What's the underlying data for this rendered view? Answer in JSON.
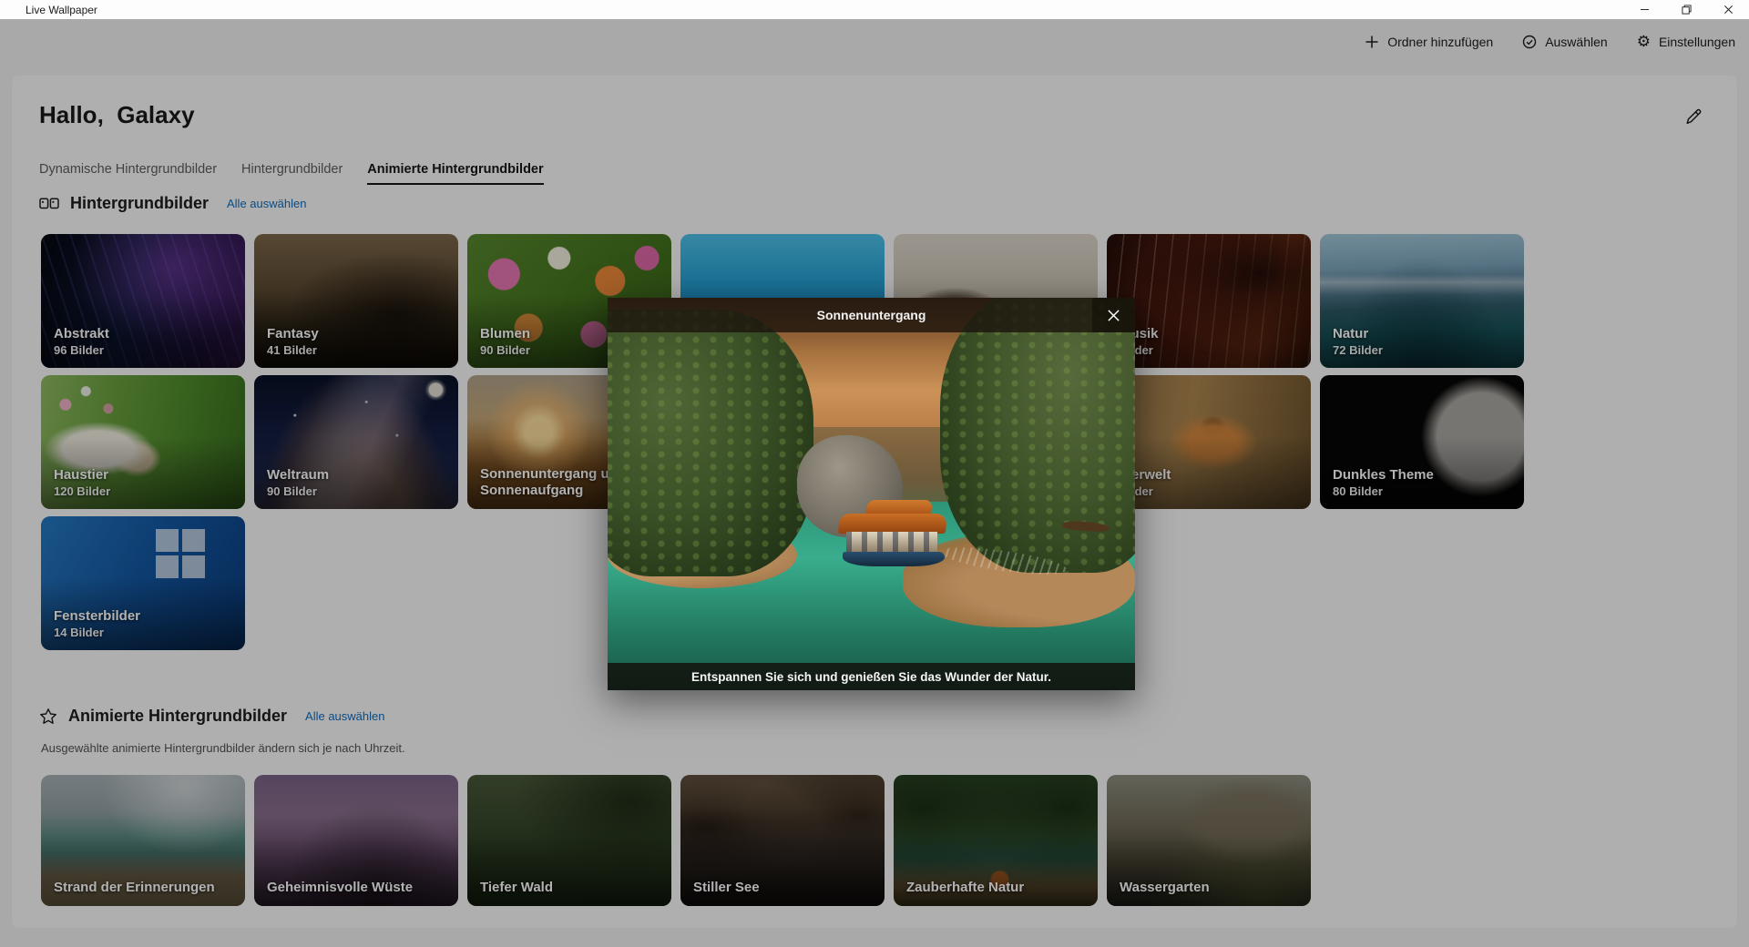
{
  "window": {
    "title": "Live Wallpaper"
  },
  "toolbar": {
    "add_folder": "Ordner hinzufügen",
    "select": "Auswählen",
    "settings": "Einstellungen"
  },
  "page": {
    "greeting": "Hallo,  Galaxy",
    "tabs": [
      {
        "label": "Dynamische Hintergrundbilder",
        "active": false
      },
      {
        "label": "Hintergrundbilder",
        "active": false
      },
      {
        "label": "Animierte Hintergrundbilder",
        "active": true
      }
    ]
  },
  "wallpaper_section": {
    "title": "Hintergrundbilder",
    "select_all": "Alle auswählen",
    "tiles": [
      {
        "name": "Abstrakt",
        "count": "96 Bilder"
      },
      {
        "name": "Fantasy",
        "count": "41 Bilder"
      },
      {
        "name": "Blumen",
        "count": "90 Bilder"
      },
      {
        "name": "",
        "count": ""
      },
      {
        "name": "",
        "count": ""
      },
      {
        "name": "Musik",
        "count": "Bilder"
      },
      {
        "name": "Natur",
        "count": "72 Bilder"
      },
      {
        "name": "Haustier",
        "count": "120 Bilder"
      },
      {
        "name": "Weltraum",
        "count": "90 Bilder"
      },
      {
        "name": "Sonnenuntergang und Sonnenaufgang",
        "count": ""
      },
      {
        "name": "",
        "count": ""
      },
      {
        "name": "",
        "count": ""
      },
      {
        "name": "Tierwelt",
        "count": "Bilder"
      },
      {
        "name": "Dunkles Theme",
        "count": "80 Bilder"
      },
      {
        "name": "Fensterbilder",
        "count": "14 Bilder"
      }
    ]
  },
  "animated_section": {
    "title": "Animierte Hintergrundbilder",
    "select_all": "Alle auswählen",
    "subtitle": "Ausgewählte animierte Hintergrundbilder ändern sich je nach Uhrzeit.",
    "tiles": [
      {
        "name": "Strand der Erinnerungen"
      },
      {
        "name": "Geheimnisvolle Wüste"
      },
      {
        "name": "Tiefer Wald"
      },
      {
        "name": "Stiller See"
      },
      {
        "name": "Zauberhafte Natur"
      },
      {
        "name": "Wassergarten"
      }
    ]
  },
  "modal": {
    "title": "Sonnenuntergang",
    "caption": "Entspannen Sie sich und genießen Sie das Wunder der Natur."
  },
  "colors": {
    "link": "#0f6cbd",
    "accent": "#0b5f96",
    "scrim": "rgba(0,0,0,0.30)"
  }
}
